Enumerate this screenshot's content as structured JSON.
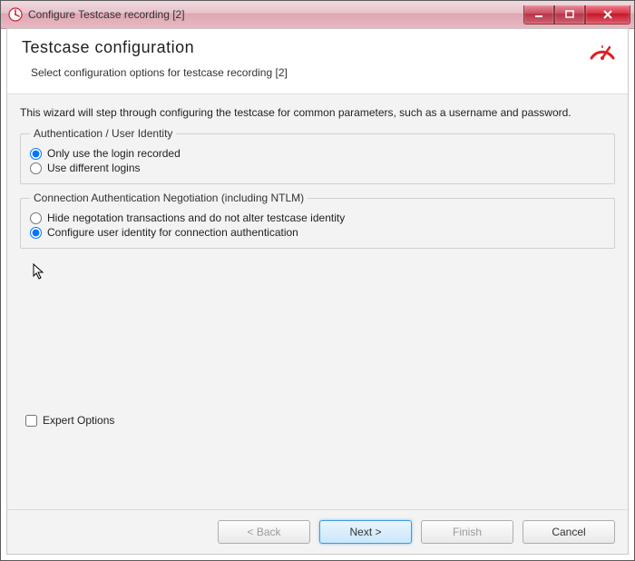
{
  "window": {
    "title": "Configure Testcase recording [2]"
  },
  "banner": {
    "title": "Testcase configuration",
    "subtitle": "Select configuration options for testcase recording [2]"
  },
  "intro": "This wizard will step through configuring the testcase for common parameters, such as a username and password.",
  "group1": {
    "legend": "Authentication / User Identity",
    "option1": "Only use the login recorded",
    "option2": "Use different logins"
  },
  "group2": {
    "legend": "Connection Authentication Negotiation (including NTLM)",
    "option1": "Hide negotation transactions and do not alter testcase identity",
    "option2": "Configure user identity for connection authentication"
  },
  "expert": {
    "label": "Expert Options"
  },
  "buttons": {
    "back": "< Back",
    "next": "Next >",
    "finish": "Finish",
    "cancel": "Cancel"
  },
  "colors": {
    "accent": "#3c9be0",
    "titlebar": "#dda7b2",
    "close": "#d73043"
  }
}
